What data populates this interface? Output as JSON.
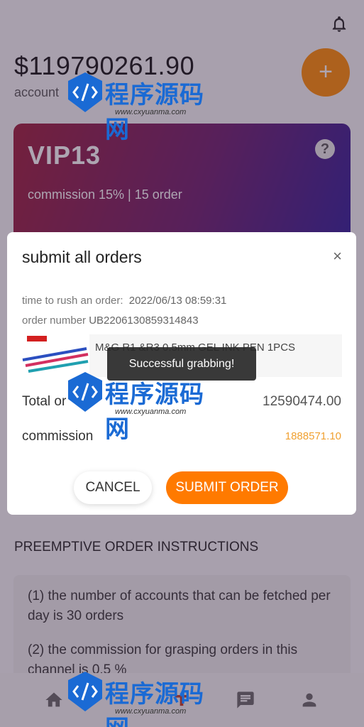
{
  "header": {
    "balance": "$119790261.90",
    "balance_label": "account"
  },
  "vip": {
    "title": "VIP13",
    "subtitle": "commission 15% | 15 order",
    "help": "?"
  },
  "modal": {
    "title": "submit all orders",
    "close": "×",
    "time_label": "time to rush an order:",
    "time_value": "2022/06/13 08:59:31",
    "order_label": "order number",
    "order_value": "UB2206130859314843",
    "product_name": "M&G R1 &R3 0.5mm GEL INK PEN 1PCS",
    "total_label": "Total or",
    "total_value": "12590474.00",
    "commission_label": "commission",
    "commission_value": "1888571.10",
    "cancel_label": "CANCEL",
    "submit_label": "SUBMIT ORDER"
  },
  "toast": {
    "message": "Successful grabbing!"
  },
  "instructions": {
    "title": "PREEMPTIVE ORDER INSTRUCTIONS",
    "items": [
      "(1) the number of accounts that can be fetched per day is 30 orders",
      "(2) the commission for grasping orders in this channel is 0.5 %"
    ]
  },
  "watermark": {
    "text": "程序源码网",
    "url": "www.cxyuanma.com"
  },
  "nav": {
    "items": [
      "home-icon",
      "grab-icon",
      "message-icon",
      "user-icon"
    ]
  },
  "colors": {
    "accent": "#ff7a00",
    "commission": "#f0a030"
  }
}
